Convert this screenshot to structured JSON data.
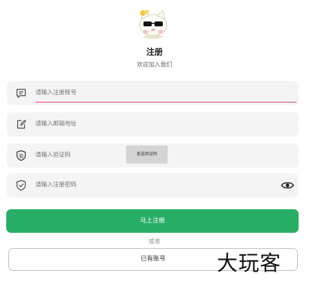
{
  "header": {
    "title": "注册",
    "subtitle": "欢迎加入我们"
  },
  "form": {
    "account": {
      "placeholder": "请输入注册账号",
      "icon": "chat-icon"
    },
    "email": {
      "placeholder": "请输入邮箱地址",
      "icon": "edit-icon"
    },
    "code": {
      "placeholder": "请输入验证码",
      "icon": "verify-badge-icon",
      "badge_char": "验",
      "send_label": "发送验证码"
    },
    "password": {
      "placeholder": "请输入注册密码",
      "icon": "shield-icon",
      "toggle_icon": "eye-icon"
    }
  },
  "actions": {
    "register_label": "马上注册",
    "or_label": "或者",
    "have_account_label": "已有账号"
  },
  "watermark": "大玩客",
  "colors": {
    "accent": "#27ae66",
    "active_underline": "#e0466f",
    "field_bg": "#f4f4f4"
  }
}
